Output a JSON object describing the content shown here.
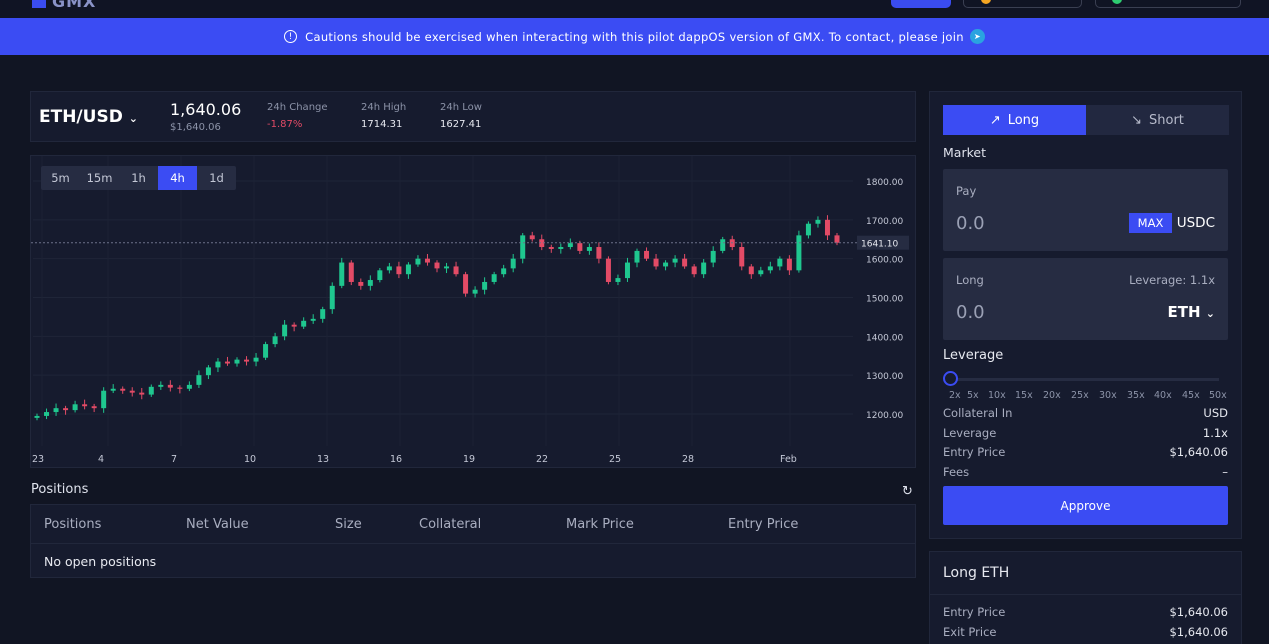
{
  "header": {
    "app_name": "GMX"
  },
  "banner": {
    "text": "Cautions should be exercised when interacting with this pilot dappOS version of GMX. To contact, please join"
  },
  "ticker": {
    "pair": "ETH/USD",
    "price": "1,640.06",
    "price_usd": "$1,640.06",
    "change_label": "24h Change",
    "change_value": "-1.87%",
    "high_label": "24h High",
    "high_value": "1714.31",
    "low_label": "24h Low",
    "low_value": "1627.41"
  },
  "timeframes": [
    "5m",
    "15m",
    "1h",
    "4h",
    "1d"
  ],
  "active_timeframe": "4h",
  "chart_data": {
    "type": "candlestick",
    "y_ticks": [
      "1800.00",
      "1700.00",
      "1600.00",
      "1500.00",
      "1400.00",
      "1300.00",
      "1200.00"
    ],
    "ylim": [
      1150,
      1820
    ],
    "x_ticks": [
      "23",
      "4",
      "7",
      "10",
      "13",
      "16",
      "19",
      "22",
      "25",
      "28",
      "Feb"
    ],
    "current_price_label": "1641.10",
    "current_price": 1641.1,
    "close_series": [
      1195,
      1205,
      1215,
      1210,
      1225,
      1220,
      1215,
      1260,
      1265,
      1260,
      1255,
      1250,
      1270,
      1275,
      1268,
      1265,
      1275,
      1300,
      1320,
      1335,
      1330,
      1340,
      1335,
      1345,
      1380,
      1400,
      1430,
      1425,
      1440,
      1445,
      1470,
      1530,
      1590,
      1540,
      1530,
      1545,
      1570,
      1580,
      1560,
      1585,
      1600,
      1590,
      1575,
      1580,
      1560,
      1510,
      1520,
      1540,
      1560,
      1575,
      1600,
      1660,
      1650,
      1630,
      1625,
      1630,
      1640,
      1620,
      1630,
      1600,
      1540,
      1550,
      1590,
      1620,
      1600,
      1580,
      1590,
      1600,
      1580,
      1560,
      1590,
      1620,
      1650,
      1630,
      1580,
      1560,
      1570,
      1580,
      1600,
      1570,
      1660,
      1690,
      1700,
      1660,
      1641
    ]
  },
  "positions": {
    "title": "Positions",
    "headers": [
      "Positions",
      "Net Value",
      "Size",
      "Collateral",
      "Mark Price",
      "Entry Price"
    ],
    "empty_text": "No open positions"
  },
  "trade": {
    "tab_long": "Long",
    "tab_short": "Short",
    "mode": "Market",
    "pay_label": "Pay",
    "pay_value": "0.0",
    "max_label": "MAX",
    "pay_token": "USDC",
    "long_label": "Long",
    "leverage_display": "Leverage: 1.1x",
    "long_value": "0.0",
    "long_token": "ETH",
    "leverage_title": "Leverage",
    "leverage_level": 1.1,
    "leverage_marks": [
      "2x",
      "5x",
      "10x",
      "15x",
      "20x",
      "25x",
      "30x",
      "35x",
      "40x",
      "45x",
      "50x"
    ],
    "details": [
      {
        "k": "Collateral In",
        "v": "USD"
      },
      {
        "k": "Leverage",
        "v": "1.1x"
      },
      {
        "k": "Entry Price",
        "v": "$1,640.06"
      },
      {
        "k": "Fees",
        "v": "–"
      }
    ],
    "approve_label": "Approve"
  },
  "summary": {
    "title": "Long ETH",
    "details": [
      {
        "k": "Entry Price",
        "v": "$1,640.06"
      },
      {
        "k": "Exit Price",
        "v": "$1,640.06"
      }
    ]
  },
  "colors": {
    "accent": "#3b4cf3",
    "up": "#1fc78f",
    "down": "#e34b66"
  }
}
